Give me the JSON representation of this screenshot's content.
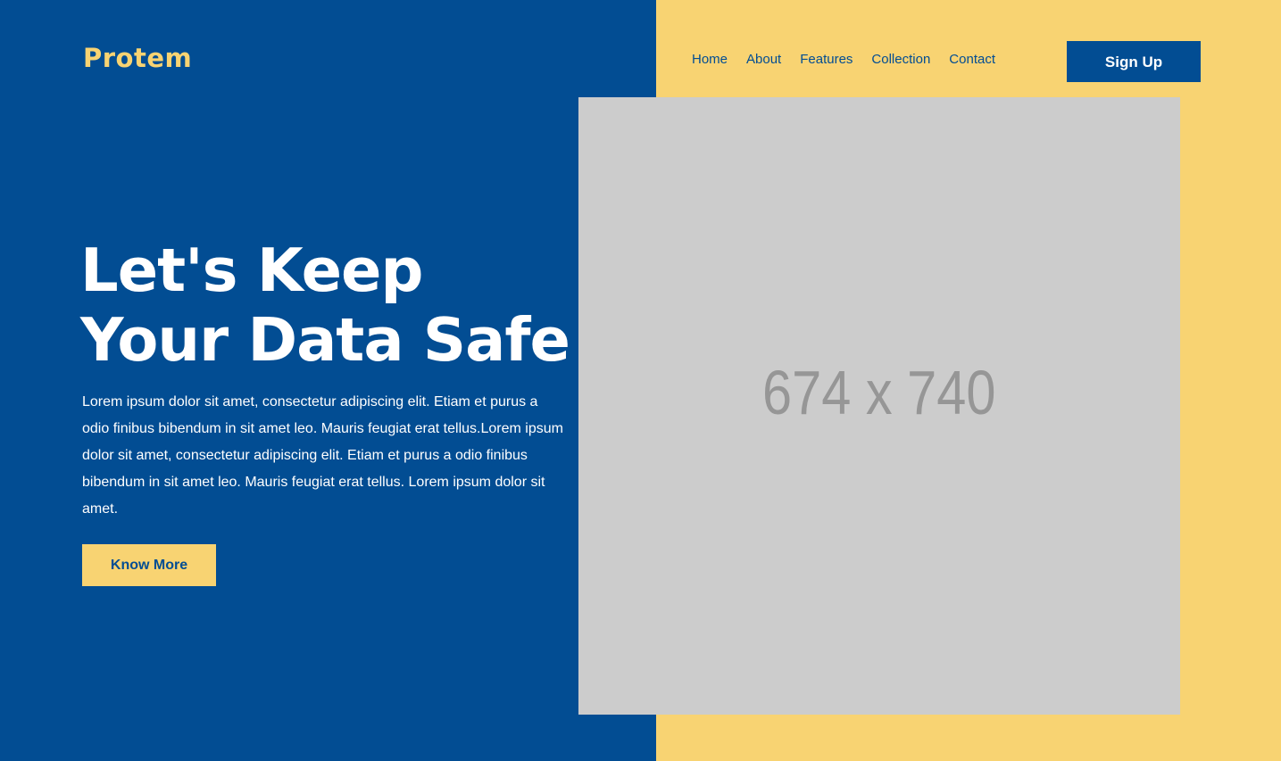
{
  "brand": {
    "logo_text": "Protem",
    "logo_color": "#f8d372"
  },
  "nav": {
    "items": [
      {
        "label": "Home"
      },
      {
        "label": "About"
      },
      {
        "label": "Features"
      },
      {
        "label": "Collection"
      },
      {
        "label": "Contact"
      }
    ],
    "signup_label": "Sign Up"
  },
  "hero": {
    "title": "Let's Keep Your Data Safe",
    "body": "Lorem ipsum dolor sit amet, consectetur adipiscing elit. Etiam et purus a odio finibus bibendum in sit amet leo. Mauris feugiat erat tellus.Lorem ipsum dolor sit amet, consectetur adipiscing elit. Etiam et purus a odio finibus bibendum in sit amet leo. Mauris feugiat erat tellus. Lorem ipsum dolor sit amet.",
    "cta_label": "Know More"
  },
  "image": {
    "placeholder_text": "674 x 740"
  },
  "colors": {
    "primary_blue": "#024d93",
    "accent_yellow": "#f8d372",
    "placeholder_gray": "#cccccc",
    "placeholder_text": "#969696"
  }
}
